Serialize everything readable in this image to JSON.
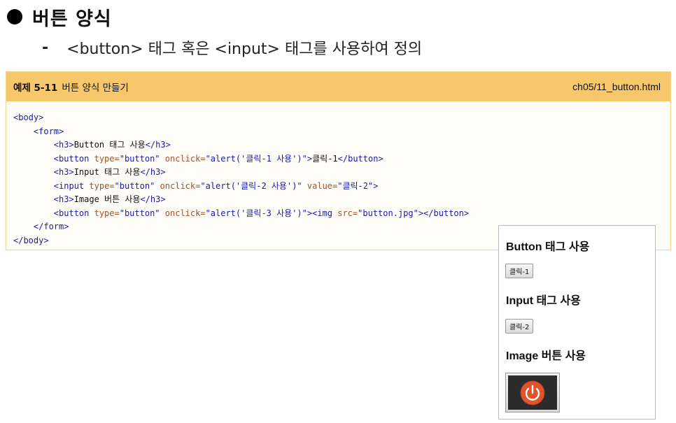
{
  "heading": "버튼 양식",
  "subline": {
    "dash": "-",
    "text": "<button> 태그 혹은 <input> 태그를 사용하여 정의"
  },
  "example": {
    "label": "예제 5-11",
    "title": "버튼 양식 만들기",
    "file": "ch05/11_button.html"
  },
  "code": {
    "l1": "<body>",
    "l2": "<form>",
    "l3_open": "<h3>",
    "l3_text": "Button 태그 사용",
    "l3_close": "</h3>",
    "l4_tag": "<button",
    "l4_attr1": "type=",
    "l4_val1": "\"button\"",
    "l4_attr2": "onclick=",
    "l4_val2": "\"alert('클릭-1 사용')\"",
    "l4_end": ">",
    "l4_text": "클릭-1",
    "l4_close": "</button>",
    "l5_open": "<h3>",
    "l5_text": "Input 태그 사용",
    "l5_close": "</h3>",
    "l6_tag": "<input",
    "l6_attr1": "type=",
    "l6_val1": "\"button\"",
    "l6_attr2": "onclick=",
    "l6_val2": "\"alert('클릭-2 사용')\"",
    "l6_attr3": "value=",
    "l6_val3": "\"클릭-2\"",
    "l6_end": ">",
    "l7_open": "<h3>",
    "l7_text": "Image 버튼 사용",
    "l7_close": "</h3>",
    "l8_tag": "<button",
    "l8_attr1": "type=",
    "l8_val1": "\"button\"",
    "l8_attr2": "onclick=",
    "l8_val2": "\"alert('클릭-3 사용')\"",
    "l8_end": "><img",
    "l8_attr3": "src=",
    "l8_val3": "\"button.jpg\"",
    "l8_close": "></button>",
    "l9": "</form>",
    "l10": "</body>"
  },
  "preview": {
    "h3_1": "Button 태그 사용",
    "btn_1": "클릭-1",
    "h3_2": "Input 태그 사용",
    "btn_2": "클릭-2",
    "h3_3": "Image 버튼 사용"
  },
  "colors": {
    "header_bg": "#f7c86b",
    "tag": "#1a1aa6",
    "attr": "#a0522d",
    "power_red": "#e0532d"
  }
}
